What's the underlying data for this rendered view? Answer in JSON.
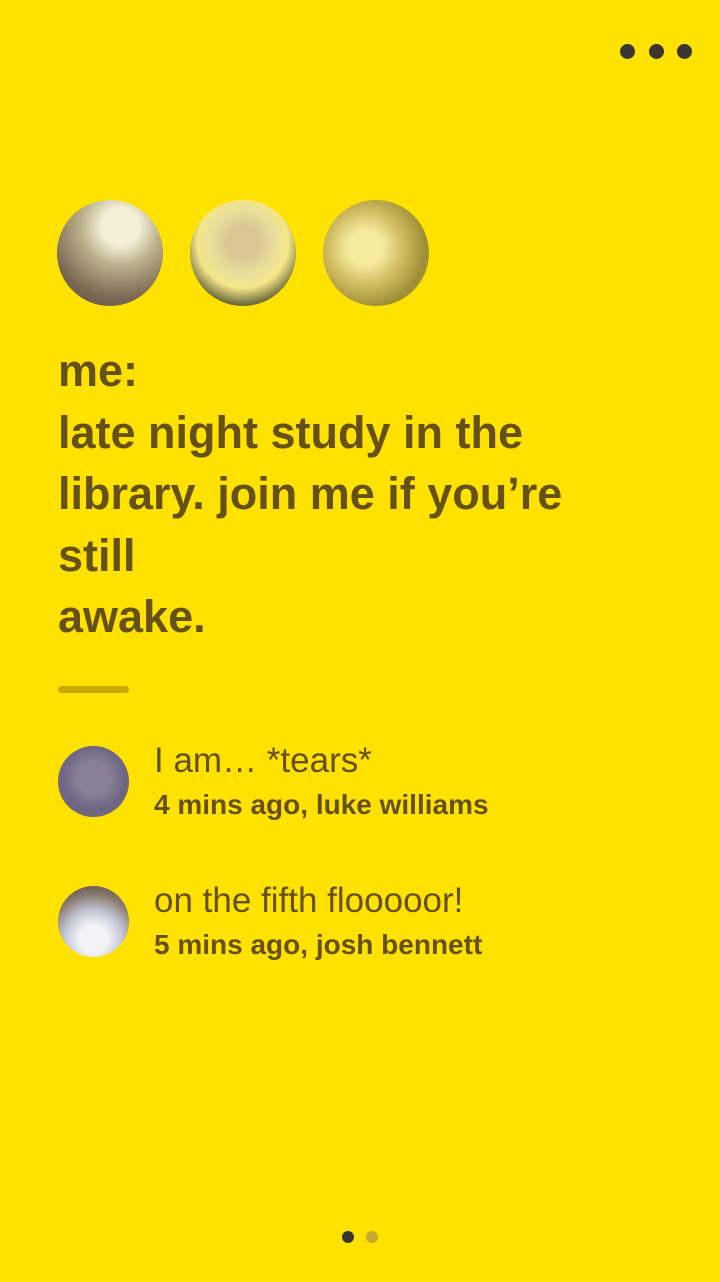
{
  "menu": {
    "icon": "more-horizontal-icon"
  },
  "participants": [
    {
      "name": "participant-1"
    },
    {
      "name": "participant-2"
    },
    {
      "name": "participant-3"
    }
  ],
  "post": {
    "author_label": "me:",
    "lines": [
      "late night study in the",
      "library. join me if you’re",
      "still",
      "awake."
    ]
  },
  "comments": [
    {
      "text": "I am… *tears*",
      "meta": "4 mins ago, luke williams"
    },
    {
      "text": "on the fifth flooooor!",
      "meta": "5 mins ago, josh bennett"
    }
  ],
  "pagination": {
    "total": 2,
    "active_index": 0
  },
  "colors": {
    "background": "#FFE200",
    "text": "#655016",
    "accent": "#C9A800",
    "dark": "#3a3530"
  }
}
